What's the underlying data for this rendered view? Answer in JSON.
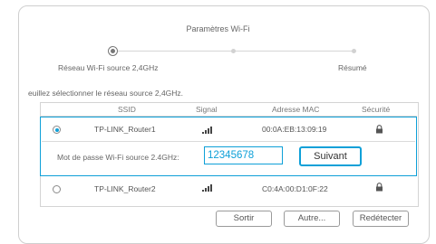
{
  "wizard": {
    "title": "Paramètres Wi-Fi",
    "steps": [
      {
        "label": "Réseau Wi-Fi source 2,4GHz",
        "state": "current"
      },
      {
        "label": "",
        "state": "pending"
      },
      {
        "label": "Résumé",
        "state": "pending"
      }
    ]
  },
  "instruction": "euillez sélectionner le réseau source 2,4GHz.",
  "table": {
    "headers": {
      "ssid": "SSID",
      "signal": "Signal",
      "mac": "Adresse MAC",
      "security": "Sécurité"
    },
    "rows": [
      {
        "ssid": "TP-LINK_Router1",
        "signal_bars": 4,
        "mac": "00:0A:EB:13:09:19",
        "security_icon": "lock-icon",
        "selected": true
      },
      {
        "ssid": "TP-LINK_Router2",
        "signal_bars": 4,
        "mac": "C0:4A:00:D1:0F:22",
        "security_icon": "lock-icon",
        "selected": false
      }
    ]
  },
  "password": {
    "label": "Mot de passe Wi-Fi source 2.4GHz:",
    "value": "12345678"
  },
  "buttons": {
    "next": "Suivant",
    "exit": "Sortir",
    "other": "Autre...",
    "rescan": "Redétecter"
  },
  "colors": {
    "accent": "#0ea0d8",
    "border": "#cfcfcf",
    "text": "#666666"
  }
}
